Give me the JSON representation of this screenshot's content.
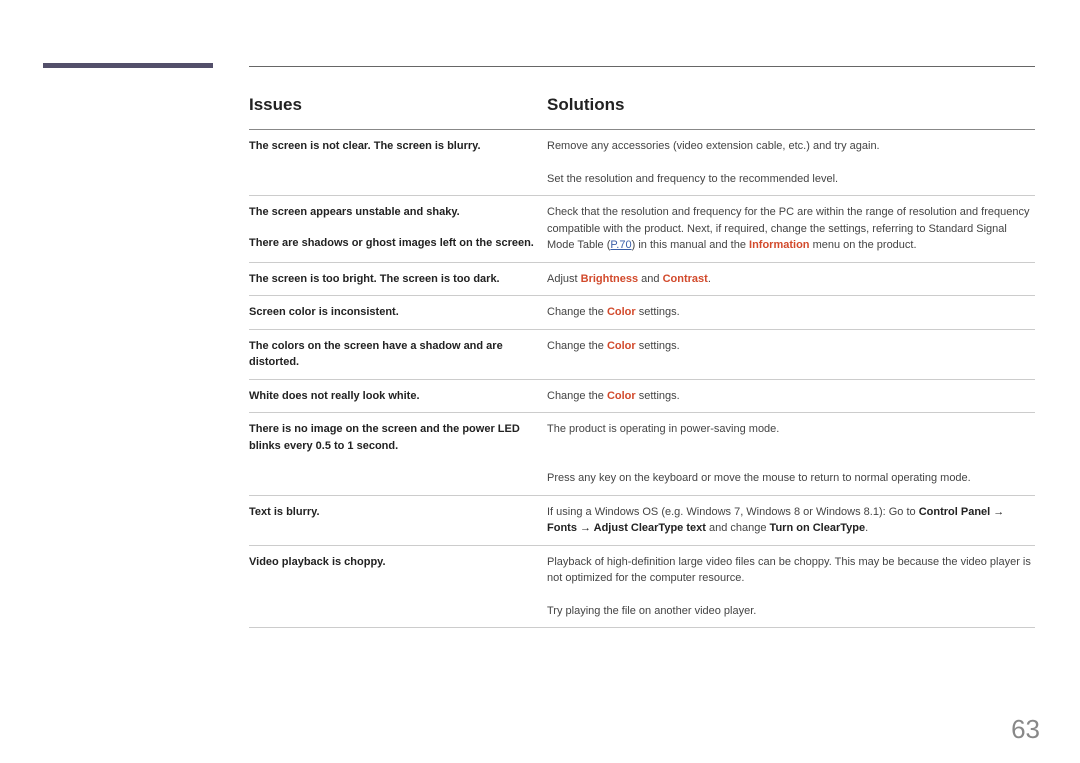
{
  "headers": {
    "issues": "Issues",
    "solutions": "Solutions"
  },
  "rows": [
    {
      "issue": "The screen is not clear. The screen is blurry.",
      "solutions": [
        "Remove any accessories (video extension cable, etc.) and try again.",
        "Set the resolution and frequency to the recommended level."
      ]
    },
    {
      "issue": "The screen appears unstable and shaky.",
      "issue2": "There are shadows or ghost images left on the screen.",
      "solution_html": "Check that the resolution and frequency for the PC are within the range of resolution and frequency compatible with the product. Next, if required, change the settings, referring to Standard Signal Mode Table (<span class='link'>P.70</span>) in this manual and the <span class='accent'>Information</span> menu on the product."
    },
    {
      "issue": "The screen is too bright. The screen is too dark.",
      "solution_html": "Adjust <span class='accent'>Brightness</span> and <span class='accent'>Contrast</span>."
    },
    {
      "issue": "Screen color is inconsistent.",
      "solution_html": "Change the <span class='accent'>Color</span> settings."
    },
    {
      "issue": "The colors on the screen have a shadow and are distorted.",
      "solution_html": "Change the <span class='accent'>Color</span> settings."
    },
    {
      "issue": "White does not really look white.",
      "solution_html": "Change the <span class='accent'>Color</span> settings."
    },
    {
      "issue": "There is no image on the screen and the power LED blinks every 0.5 to 1 second.",
      "solutions": [
        "The product is operating in power-saving mode.",
        "Press any key on the keyboard or move the mouse to return to normal operating mode."
      ]
    },
    {
      "issue": "Text is blurry.",
      "solution_html": "If using a Windows OS (e.g. Windows 7, Windows 8 or Windows 8.1): Go to <span class='bold'>Control Panel → Fonts → Adjust ClearType text</span> and change <span class='bold'>Turn on ClearType</span>."
    },
    {
      "issue": "Video playback is choppy.",
      "solutions": [
        "Playback of high-definition large video files can be choppy. This may be because the video player is not optimized for the computer resource.",
        "Try playing the file on another video player."
      ]
    }
  ],
  "page_number": "63",
  "link_p70": "P.70",
  "accent_words": {
    "information": "Information",
    "brightness": "Brightness",
    "contrast": "Contrast",
    "color": "Color"
  },
  "bold_phrases": {
    "control_panel_fonts": "Control Panel → Fonts → Adjust ClearType text",
    "turn_on": "Turn on ClearType"
  }
}
